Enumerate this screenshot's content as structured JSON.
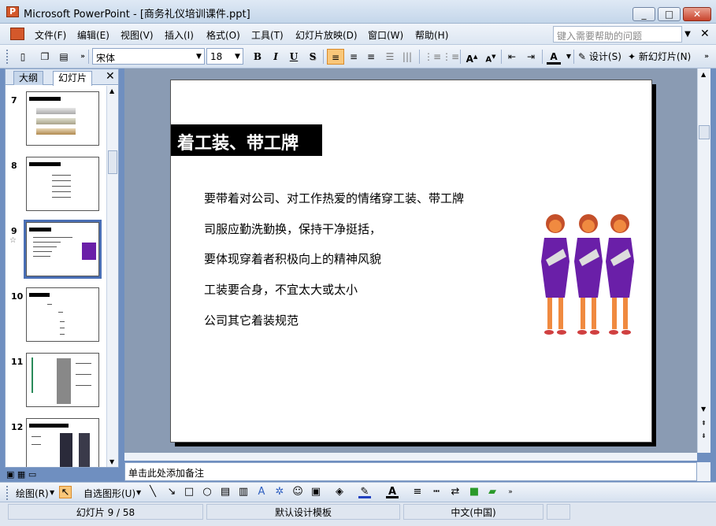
{
  "window": {
    "title": "Microsoft PowerPoint - [商务礼仪培训课件.ppt]"
  },
  "menu": {
    "items": [
      "文件(F)",
      "编辑(E)",
      "视图(V)",
      "插入(I)",
      "格式(O)",
      "工具(T)",
      "幻灯片放映(D)",
      "窗口(W)",
      "帮助(H)"
    ],
    "help_placeholder": "键入需要帮助的问题"
  },
  "format_toolbar": {
    "font_name": "宋体",
    "font_size": "18",
    "bold": "B",
    "italic": "I",
    "underline": "U",
    "shadow": "S",
    "design_label": "设计(S)",
    "new_slide_label": "新幻灯片(N)"
  },
  "pane": {
    "tabs": [
      "大纲",
      "幻灯片"
    ],
    "thumbnails": [
      "7",
      "8",
      "9",
      "10",
      "11",
      "12"
    ],
    "selected": "9"
  },
  "slide": {
    "title": "着工装、带工牌",
    "bullets": [
      "要带着对公司、对工作热爱的情绪穿工装、带工牌",
      "司服应勤洗勤换，保持干净挺括，",
      " 要体现穿着者积极向上的精神风貌",
      "工装要合身，不宜太大或太小",
      "公司其它着装规范"
    ]
  },
  "notes": {
    "placeholder": "单击此处添加备注"
  },
  "draw_toolbar": {
    "draw_label": "绘图(R)",
    "autoshapes_label": "自选图形(U)"
  },
  "status": {
    "slide_info": "幻灯片 9 / 58",
    "template": "默认设计模板",
    "language": "中文(中国)"
  },
  "colors": {
    "accent_selected": "#4a6fb5",
    "women_dress": "#6a1fa8",
    "women_skin": "#f08a40"
  }
}
